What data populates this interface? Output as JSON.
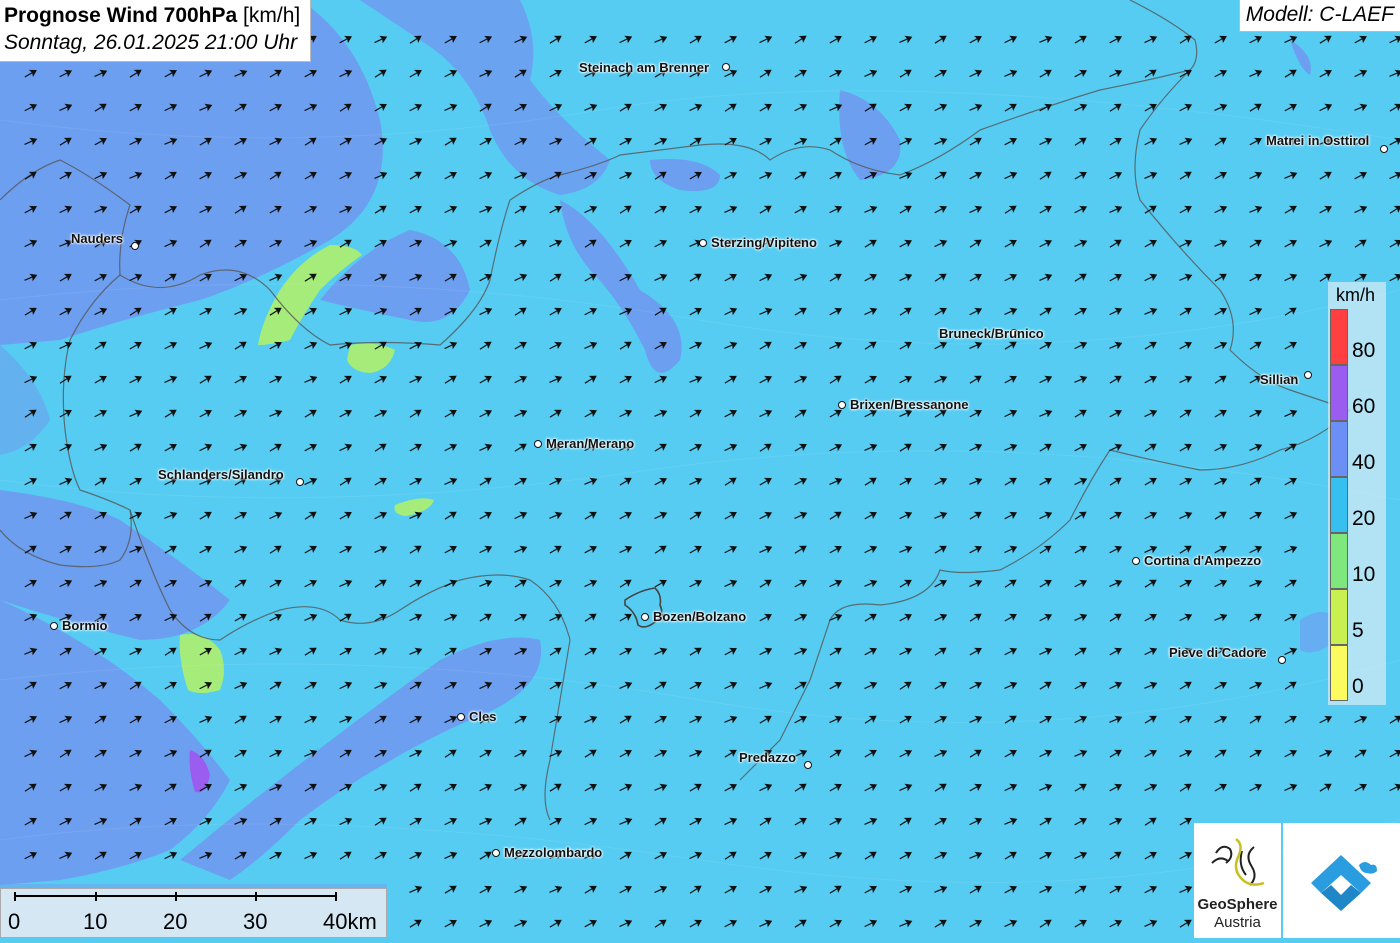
{
  "header": {
    "title_bold": "Prognose Wind 700hPa",
    "title_unit": " [km/h]",
    "datetime": "Sonntag, 26.01.2025 21:00 Uhr",
    "model": "Modell: C-LAEF"
  },
  "legend": {
    "unit": "km/h",
    "classes": [
      {
        "label": "80",
        "color": "#ff4040"
      },
      {
        "label": "60",
        "color": "#9b5cf0"
      },
      {
        "label": "40",
        "color": "#6b8ff5"
      },
      {
        "label": "20",
        "color": "#35c0ef"
      },
      {
        "label": "10",
        "color": "#7ee87e"
      },
      {
        "label": "5",
        "color": "#c8f050"
      },
      {
        "label": "0",
        "color": "#fbfb60"
      }
    ]
  },
  "scale_bar": {
    "labels": [
      "0",
      "10",
      "20",
      "30",
      "40km"
    ]
  },
  "cities": [
    {
      "name": "Steinach am Brenner"
    },
    {
      "name": "Matrei in Osttirol"
    },
    {
      "name": "Nauders"
    },
    {
      "name": "Sterzing/Vipiteno"
    },
    {
      "name": "Bruneck/Brunico"
    },
    {
      "name": "Sillian"
    },
    {
      "name": "Brixen/Bressanone"
    },
    {
      "name": "Meran/Merano"
    },
    {
      "name": "Schlanders/Silandro"
    },
    {
      "name": "Cortina d'Ampezzo"
    },
    {
      "name": "Bozen/Bolzano"
    },
    {
      "name": "Bormio"
    },
    {
      "name": "Pieve di Cadore"
    },
    {
      "name": "Cles"
    },
    {
      "name": "Predazzo"
    },
    {
      "name": "Mezzolombardo"
    }
  ],
  "logos": {
    "geosphere_line1": "GeoSphere",
    "geosphere_line2": "Austria"
  },
  "colors": {
    "field_main": "#56ccf2",
    "field_strong": "#6f9cf0",
    "field_weak": "#a6ec7a",
    "arrow": "#111111"
  }
}
